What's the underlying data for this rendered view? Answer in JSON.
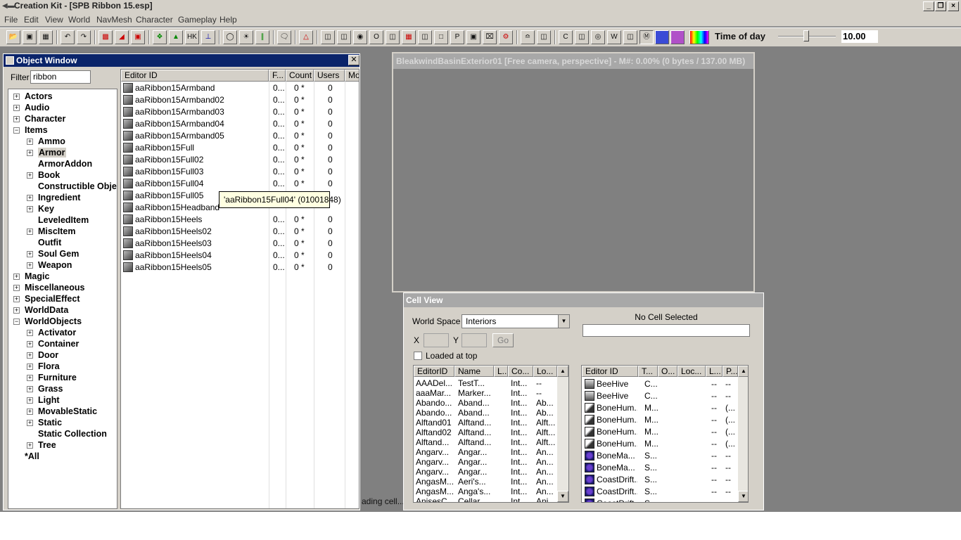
{
  "window": {
    "title": "Creation Kit - [SPB Ribbon 15.esp]"
  },
  "menu": [
    "File",
    "Edit",
    "View",
    "World",
    "NavMesh",
    "Character",
    "Gameplay",
    "Help"
  ],
  "toolbar": {
    "time_of_day_label": "Time of day",
    "time_of_day_value": "10.00"
  },
  "object_window": {
    "title": "Object Window",
    "filter_label": "Filter",
    "filter_value": "ribbon",
    "tree": [
      {
        "label": "Actors",
        "box": "+"
      },
      {
        "label": "Audio",
        "box": "+"
      },
      {
        "label": "Character",
        "box": "+"
      },
      {
        "label": "Items",
        "box": "-"
      },
      {
        "label": "Ammo",
        "box": "+"
      },
      {
        "label": "Armor",
        "box": "+"
      },
      {
        "label": "ArmorAddon",
        "box": ""
      },
      {
        "label": "Book",
        "box": "+"
      },
      {
        "label": "Constructible Objec",
        "box": ""
      },
      {
        "label": "Ingredient",
        "box": "+"
      },
      {
        "label": "Key",
        "box": "+"
      },
      {
        "label": "LeveledItem",
        "box": ""
      },
      {
        "label": "MiscItem",
        "box": "+"
      },
      {
        "label": "Outfit",
        "box": ""
      },
      {
        "label": "Soul Gem",
        "box": "+"
      },
      {
        "label": "Weapon",
        "box": "+"
      },
      {
        "label": "Magic",
        "box": "+"
      },
      {
        "label": "Miscellaneous",
        "box": "+"
      },
      {
        "label": "SpecialEffect",
        "box": "+"
      },
      {
        "label": "WorldData",
        "box": "+"
      },
      {
        "label": "WorldObjects",
        "box": "-"
      },
      {
        "label": "Activator",
        "box": "+"
      },
      {
        "label": "Container",
        "box": "+"
      },
      {
        "label": "Door",
        "box": "+"
      },
      {
        "label": "Flora",
        "box": "+"
      },
      {
        "label": "Furniture",
        "box": "+"
      },
      {
        "label": "Grass",
        "box": "+"
      },
      {
        "label": "Light",
        "box": "+"
      },
      {
        "label": "MovableStatic",
        "box": "+"
      },
      {
        "label": "Static",
        "box": "+"
      },
      {
        "label": "Static Collection",
        "box": ""
      },
      {
        "label": "Tree",
        "box": "+"
      },
      {
        "label": "*All",
        "box": ""
      }
    ],
    "columns": [
      "Editor ID",
      "F...",
      "Count",
      "Users",
      "Mo"
    ],
    "rows": [
      {
        "id": "aaRibbon15Armband",
        "f": "0...",
        "count": "0 *",
        "users": "0"
      },
      {
        "id": "aaRibbon15Armband02",
        "f": "0...",
        "count": "0 *",
        "users": "0"
      },
      {
        "id": "aaRibbon15Armband03",
        "f": "0...",
        "count": "0 *",
        "users": "0"
      },
      {
        "id": "aaRibbon15Armband04",
        "f": "0...",
        "count": "0 *",
        "users": "0"
      },
      {
        "id": "aaRibbon15Armband05",
        "f": "0...",
        "count": "0 *",
        "users": "0"
      },
      {
        "id": "aaRibbon15Full",
        "f": "0...",
        "count": "0 *",
        "users": "0"
      },
      {
        "id": "aaRibbon15Full02",
        "f": "0...",
        "count": "0 *",
        "users": "0"
      },
      {
        "id": "aaRibbon15Full03",
        "f": "0...",
        "count": "0 *",
        "users": "0"
      },
      {
        "id": "aaRibbon15Full04",
        "f": "0...",
        "count": "0 *",
        "users": "0"
      },
      {
        "id": "aaRibbon15Full05",
        "f": "",
        "count": "",
        "users": ""
      },
      {
        "id": "aaRibbon15Headband",
        "f": "",
        "count": "",
        "users": ""
      },
      {
        "id": "aaRibbon15Heels",
        "f": "0...",
        "count": "0 *",
        "users": "0"
      },
      {
        "id": "aaRibbon15Heels02",
        "f": "0...",
        "count": "0 *",
        "users": "0"
      },
      {
        "id": "aaRibbon15Heels03",
        "f": "0...",
        "count": "0 *",
        "users": "0"
      },
      {
        "id": "aaRibbon15Heels04",
        "f": "0...",
        "count": "0 *",
        "users": "0"
      },
      {
        "id": "aaRibbon15Heels05",
        "f": "0...",
        "count": "0 *",
        "users": "0"
      }
    ],
    "tooltip": "'aaRibbon15Full04' (01001848)"
  },
  "render_window": {
    "title": "BleakwindBasinExterior01 [Free camera, perspective] - M#: 0.00% (0 bytes / 137.00 MB)"
  },
  "status": {
    "left": "ading cell..."
  },
  "cell_view": {
    "title": "Cell View",
    "world_space_label": "World Space",
    "world_space_value": "Interiors",
    "x_label": "X",
    "y_label": "Y",
    "go_label": "Go",
    "loaded_at_top": "Loaded at top",
    "no_cell": "No Cell Selected",
    "cells_columns": [
      "EditorID",
      "Name",
      "L...",
      "Co...",
      "Lo..."
    ],
    "cells": [
      [
        "AAADel...",
        "TestT...",
        "",
        "Int...",
        "--"
      ],
      [
        "aaaMar...",
        "Marker...",
        "",
        "Int...",
        "--"
      ],
      [
        "Abando...",
        "Aband...",
        "",
        "Int...",
        "Ab..."
      ],
      [
        "Abando...",
        "Aband...",
        "",
        "Int...",
        "Ab..."
      ],
      [
        "Alftand01",
        "Alftand...",
        "",
        "Int...",
        "Alft..."
      ],
      [
        "Alftand02",
        "Alftand...",
        "",
        "Int...",
        "Alft..."
      ],
      [
        "Alftand...",
        "Alftand...",
        "",
        "Int...",
        "Alft..."
      ],
      [
        "Angarv...",
        "Angar...",
        "",
        "Int...",
        "An..."
      ],
      [
        "Angarv...",
        "Angar...",
        "",
        "Int...",
        "An..."
      ],
      [
        "Angarv...",
        "Angar...",
        "",
        "Int...",
        "An..."
      ],
      [
        "AngasM...",
        "Aeri's...",
        "",
        "Int...",
        "An..."
      ],
      [
        "AngasM...",
        "Anga's...",
        "",
        "Int...",
        "An..."
      ],
      [
        "AnisesC...",
        "Cellar",
        "",
        "Int...",
        "Ani..."
      ]
    ],
    "refs_columns": [
      "Editor ID",
      "T...",
      "O...",
      "Loc...",
      "L...",
      "P..."
    ],
    "refs": [
      {
        "id": "BeeHive",
        "t": "C...",
        "l": "--",
        "p": "--",
        "icon": "container-icon"
      },
      {
        "id": "BeeHive",
        "t": "C...",
        "l": "--",
        "p": "--",
        "icon": "container-icon"
      },
      {
        "id": "BoneHum...",
        "t": "M...",
        "l": "--",
        "p": "(...",
        "icon": "bone-icon"
      },
      {
        "id": "BoneHum...",
        "t": "M...",
        "l": "--",
        "p": "(...",
        "icon": "bone-icon"
      },
      {
        "id": "BoneHum...",
        "t": "M...",
        "l": "--",
        "p": "(...",
        "icon": "bone-icon"
      },
      {
        "id": "BoneHum...",
        "t": "M...",
        "l": "--",
        "p": "(...",
        "icon": "bone-icon"
      },
      {
        "id": "BoneMa...",
        "t": "S...",
        "l": "--",
        "p": "--",
        "icon": "static-icon"
      },
      {
        "id": "BoneMa...",
        "t": "S...",
        "l": "--",
        "p": "--",
        "icon": "static-icon"
      },
      {
        "id": "CoastDrift...",
        "t": "S...",
        "l": "--",
        "p": "--",
        "icon": "static-icon"
      },
      {
        "id": "CoastDrift...",
        "t": "S...",
        "l": "--",
        "p": "--",
        "icon": "static-icon"
      },
      {
        "id": "CoastDrift...",
        "t": "S...",
        "l": "",
        "p": "",
        "icon": "static-icon"
      }
    ]
  }
}
